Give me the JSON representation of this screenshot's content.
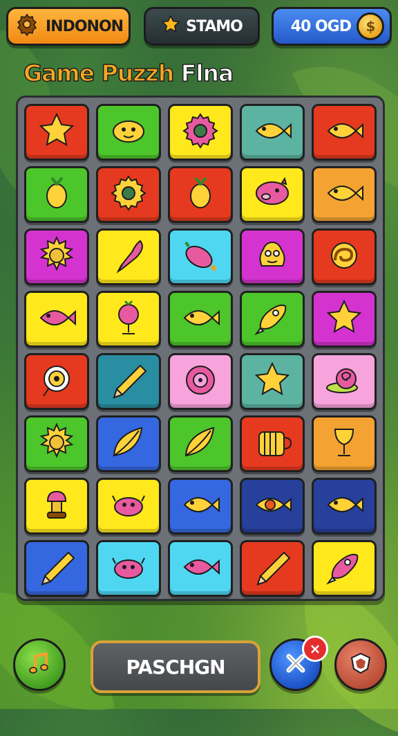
{
  "hud": {
    "left_label": "INDONON",
    "middle_label": "STAMO",
    "right_label": "40 OGD"
  },
  "title": {
    "part1": "Game Puzzh",
    "part2": "Flna"
  },
  "bottom": {
    "main_button_label": "PASCHGN",
    "close_badge": "×"
  },
  "colors": {
    "red": "#e53a1f",
    "green": "#4cc62a",
    "yellow": "#ffe81c",
    "teal": "#5cb3a1",
    "orange": "#f4a333",
    "magenta": "#d433cf",
    "cyan": "#4fd7f2",
    "pink": "#f7a3dc",
    "darkblue": "#27409c",
    "blue": "#3568e0",
    "darkteal": "#2a8ea3"
  },
  "board": {
    "rows": [
      [
        "red:star-icon",
        "green:blob-creature-icon",
        "yellow:gear-icon",
        "teal:fish-icon",
        "red:fish-icon"
      ],
      [
        "green:berry-icon",
        "red:gear-icon",
        "red:berry-icon",
        "yellow:pig-creature-icon",
        "orange:fish-icon"
      ],
      [
        "magenta:sun-icon",
        "yellow:feather-pen-icon",
        "cyan:eggplant-icon",
        "magenta:monster-icon",
        "red:coil-icon"
      ],
      [
        "yellow:fish-icon",
        "yellow:berry-stand-icon",
        "green:fish-icon",
        "green:rocket-icon",
        "magenta:star-icon"
      ],
      [
        "red:target-icon",
        "darkteal:pencil-icon",
        "pink:record-icon",
        "teal:star-icon",
        "pink:snail-icon"
      ],
      [
        "green:sun-icon",
        "blue:leaf-icon",
        "green:leaf-icon",
        "red:barrel-icon",
        "orange:goblet-icon"
      ],
      [
        "yellow:lamp-icon",
        "yellow:crab-icon",
        "blue:fish-icon",
        "darkblue:eye-fish-icon",
        "darkblue:fish-icon"
      ],
      [
        "blue:pencil-icon",
        "cyan:crab-icon",
        "cyan:fish-icon",
        "red:pencil-icon",
        "yellow:rocket-icon"
      ]
    ]
  }
}
